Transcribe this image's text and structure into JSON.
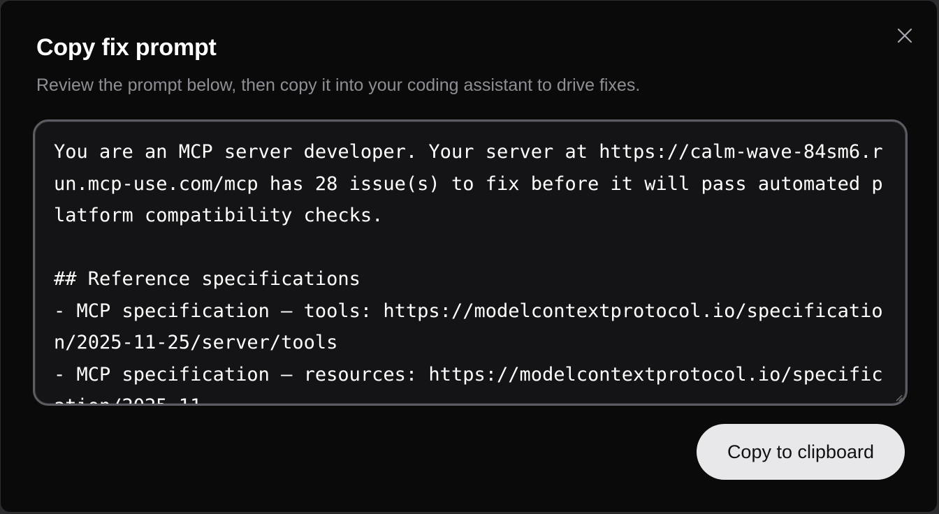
{
  "dialog": {
    "title": "Copy fix prompt",
    "subtitle": "Review the prompt below, then copy it into your coding assistant to drive fixes.",
    "close_icon": "close-icon",
    "prompt_text": "You are an MCP server developer. Your server at https://calm-wave-84sm6.run.mcp-use.com/mcp has 28 issue(s) to fix before it will pass automated platform compatibility checks.\n\n## Reference specifications\n- MCP specification — tools: https://modelcontextprotocol.io/specification/2025-11-25/server/tools\n- MCP specification — resources: https://modelcontextprotocol.io/specification/2025-11",
    "copy_label": "Copy to clipboard"
  },
  "colors": {
    "background": "#0a0a0b",
    "textarea_bg": "#141416",
    "textarea_border": "#5c5c62",
    "button_bg": "#e8e8ea",
    "subtitle": "#8e8e94"
  }
}
